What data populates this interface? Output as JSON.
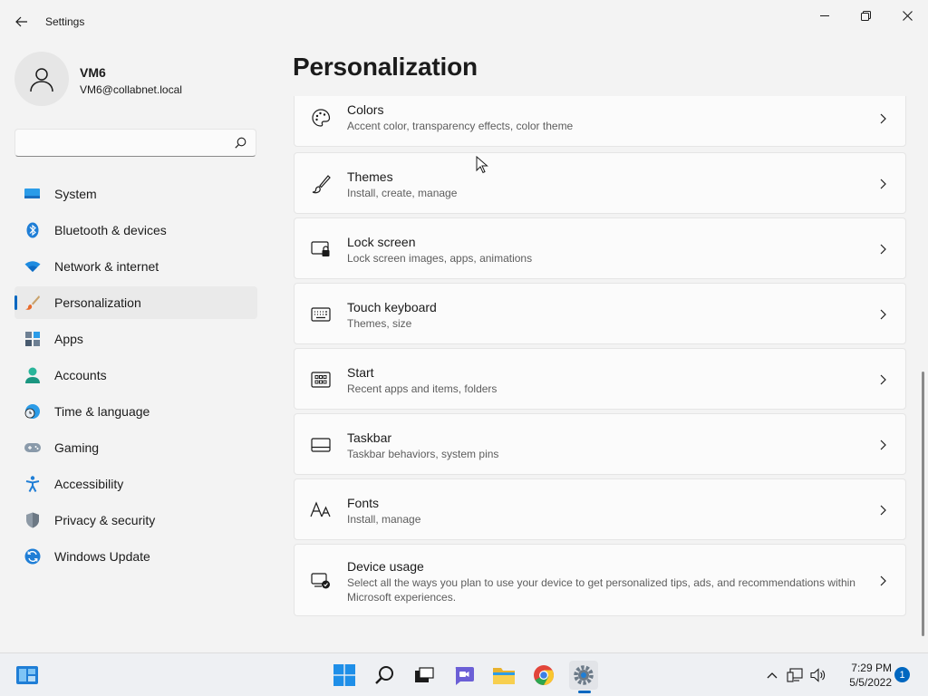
{
  "window": {
    "title": "Settings"
  },
  "profile": {
    "name": "VM6",
    "email": "VM6@collabnet.local"
  },
  "search": {
    "value": "",
    "placeholder": ""
  },
  "sidebar": {
    "items": [
      {
        "label": "System",
        "icon": "system-icon",
        "active": false
      },
      {
        "label": "Bluetooth & devices",
        "icon": "bluetooth-icon",
        "active": false
      },
      {
        "label": "Network & internet",
        "icon": "wifi-icon",
        "active": false
      },
      {
        "label": "Personalization",
        "icon": "brush-icon",
        "active": true
      },
      {
        "label": "Apps",
        "icon": "apps-icon",
        "active": false
      },
      {
        "label": "Accounts",
        "icon": "person-icon",
        "active": false
      },
      {
        "label": "Time & language",
        "icon": "clock-globe-icon",
        "active": false
      },
      {
        "label": "Gaming",
        "icon": "gamepad-icon",
        "active": false
      },
      {
        "label": "Accessibility",
        "icon": "accessibility-icon",
        "active": false
      },
      {
        "label": "Privacy & security",
        "icon": "shield-icon",
        "active": false
      },
      {
        "label": "Windows Update",
        "icon": "update-icon",
        "active": false
      }
    ]
  },
  "main": {
    "title": "Personalization",
    "cards": [
      {
        "title": "Colors",
        "subtitle": "Accent color, transparency effects, color theme",
        "icon": "palette-icon"
      },
      {
        "title": "Themes",
        "subtitle": "Install, create, manage",
        "icon": "brush-pen-icon"
      },
      {
        "title": "Lock screen",
        "subtitle": "Lock screen images, apps, animations",
        "icon": "lock-screen-icon"
      },
      {
        "title": "Touch keyboard",
        "subtitle": "Themes, size",
        "icon": "keyboard-icon"
      },
      {
        "title": "Start",
        "subtitle": "Recent apps and items, folders",
        "icon": "start-icon"
      },
      {
        "title": "Taskbar",
        "subtitle": "Taskbar behaviors, system pins",
        "icon": "taskbar-icon"
      },
      {
        "title": "Fonts",
        "subtitle": "Install, manage",
        "icon": "fonts-icon"
      },
      {
        "title": "Device usage",
        "subtitle": "Select all the ways you plan to use your device to get personalized tips, ads, and recommendations within Microsoft experiences.",
        "icon": "device-usage-icon"
      }
    ]
  },
  "taskbar": {
    "time": "7:29 PM",
    "date": "5/5/2022",
    "notification_count": "1",
    "apps": [
      "widgets-icon",
      "start-icon",
      "search-icon",
      "task-view-icon",
      "chat-icon",
      "file-explorer-icon",
      "chrome-icon",
      "settings-icon"
    ]
  },
  "colors": {
    "accent": "#0067c0",
    "background": "#f3f3f3",
    "card": "#fbfbfb"
  }
}
